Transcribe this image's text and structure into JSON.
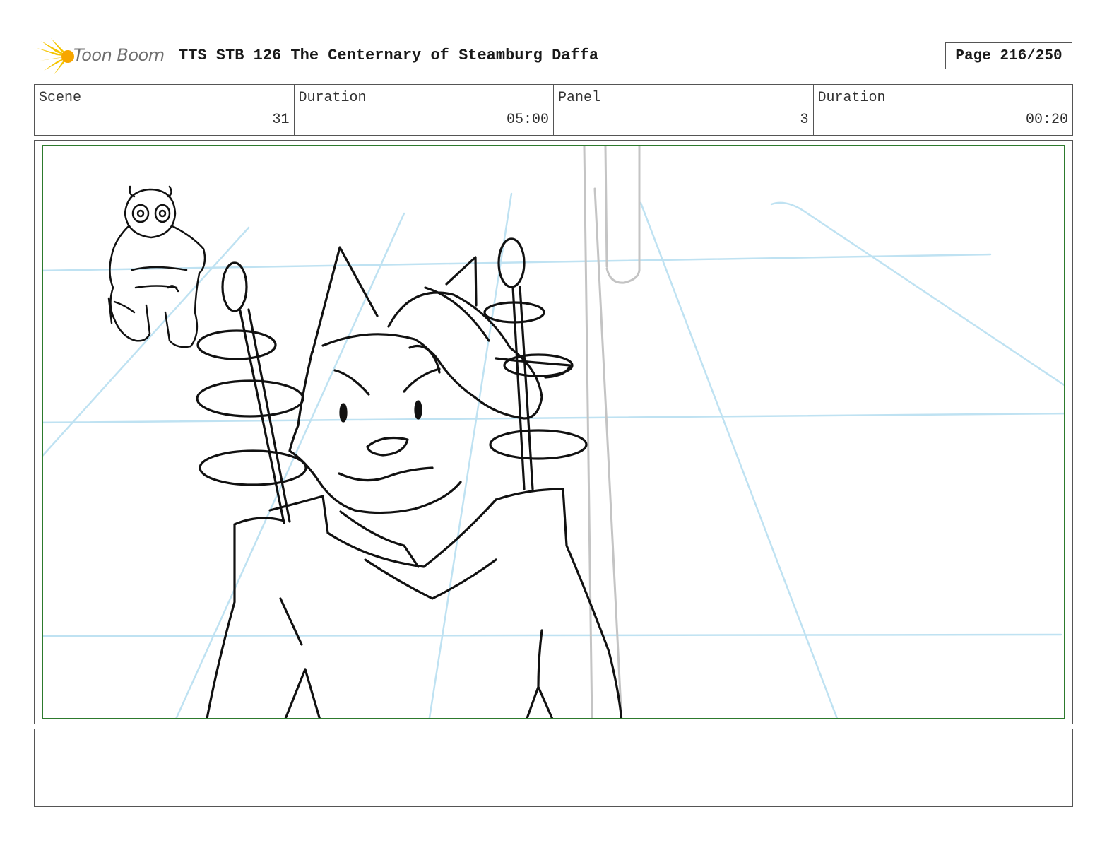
{
  "header": {
    "logo_text": "Toon Boom",
    "title": "TTS STB 126 The Centernary of Steamburg Daffa",
    "page": "Page 216/250"
  },
  "info": {
    "scene_label": "Scene",
    "scene_value": "31",
    "scene_duration_label": "Duration",
    "scene_duration_value": "05:00",
    "panel_label": "Panel",
    "panel_value": "3",
    "panel_duration_label": "Duration",
    "panel_duration_value": "00:20"
  },
  "colors": {
    "frame_border": "#2d7a2d",
    "guide_lines": "#bfe2f2",
    "sketch": "#111111",
    "pillar": "#c4c4c4",
    "logo_accent": "#f5c400"
  },
  "notes": ""
}
